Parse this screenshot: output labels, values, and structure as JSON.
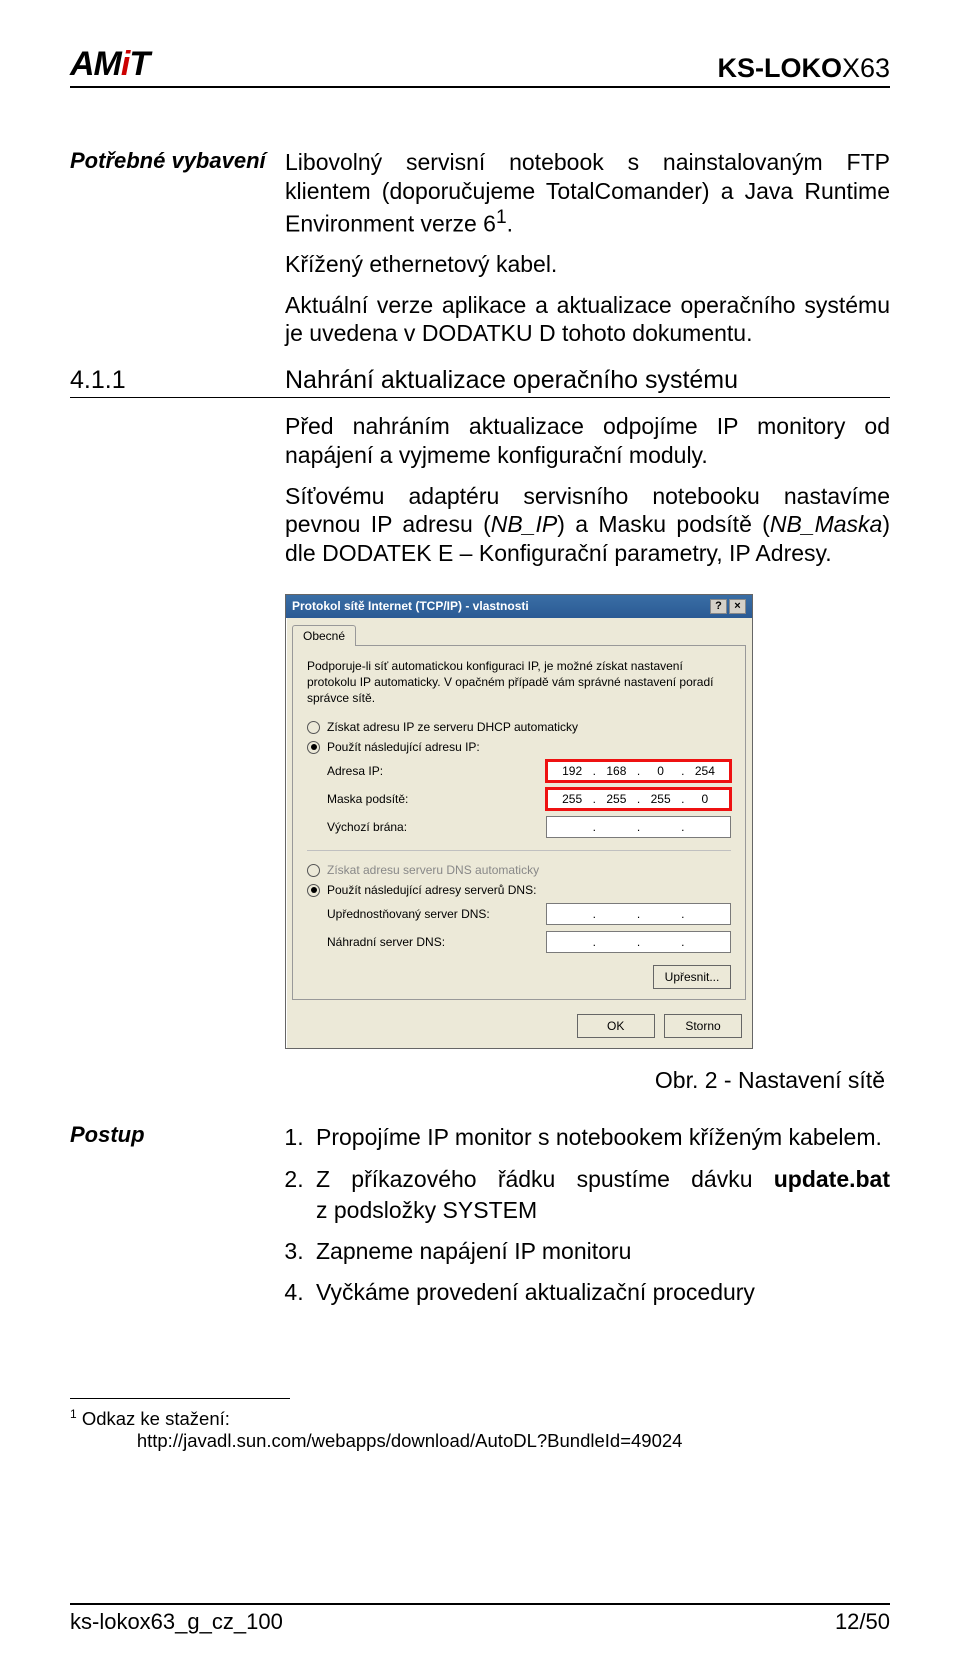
{
  "header": {
    "logo_a": "AM",
    "logo_i": "i",
    "logo_t": "T",
    "doc_id": "KS-LOKO",
    "doc_id_thin": "X63"
  },
  "margin": {
    "equip": "Potřebné vybavení",
    "proc": "Postup"
  },
  "para": {
    "p1a": "Libovolný servisní notebook s nainstalovaným FTP klientem (doporučujeme TotalComander) a Java Runtime Environment verze 6",
    "p1sup": "1",
    "p1b": ".",
    "p2": "Křížený ethernetový kabel.",
    "p3": "Aktuální verze aplikace a aktualizace operačního systému je uvedena v DODATKU D tohoto dokumentu."
  },
  "section": {
    "num": "4.1.1",
    "title": "Nahrání aktualizace operačního systému"
  },
  "para2": {
    "p4": "Před nahráním aktualizace odpojíme IP monitory od napájení a vyjmeme konfigurační moduly.",
    "p5a": "Síťovému adaptéru servisního notebooku nastavíme pevnou IP adresu (",
    "p5b": "NB_IP",
    "p5c": ") a Masku podsítě (",
    "p5d": "NB_Maska",
    "p5e": ") dle DODATEK E – Konfigurační parametry, IP Adresy."
  },
  "dialog": {
    "title": "Protokol sítě Internet (TCP/IP) - vlastnosti",
    "help": "?",
    "close": "×",
    "tab": "Obecné",
    "desc": "Podporuje-li síť automatickou konfiguraci IP, je možné získat nastavení protokolu IP automaticky. V opačném případě vám správné nastavení poradí správce sítě.",
    "r1": "Získat adresu IP ze serveru DHCP automaticky",
    "r2": "Použít následující adresu IP:",
    "f_ip": "Adresa IP:",
    "f_mask": "Maska podsítě:",
    "f_gw": "Výchozí brána:",
    "ip": [
      "192",
      "168",
      "0",
      "254"
    ],
    "mask": [
      "255",
      "255",
      "255",
      "0"
    ],
    "r3": "Získat adresu serveru DNS automaticky",
    "r4": "Použít následující adresy serverů DNS:",
    "f_dns1": "Upřednostňovaný server DNS:",
    "f_dns2": "Náhradní server DNS:",
    "adv": "Upřesnit...",
    "ok": "OK",
    "cancel": "Storno"
  },
  "caption": "Obr. 2 -   Nastavení sítě",
  "steps": {
    "s1": "Propojíme IP monitor s notebookem kříženým kabelem.",
    "s2a": "Z ",
    "s2b": "příkazového",
    "s2c": "řádku",
    "s2d": "spustíme",
    "s2e": "dávku",
    "s2bold": "update.bat",
    "s2f": "z podsložky SYSTEM",
    "s3": "Zapneme napájení IP monitoru",
    "s4": "Vyčkáme provedení aktualizační procedury"
  },
  "footnote": {
    "sup": "1",
    "label": " Odkaz ke stažení:",
    "url": "http://javadl.sun.com/webapps/download/AutoDL?BundleId=49024"
  },
  "footer": {
    "left": "ks-lokox63_g_cz_100",
    "right": "12/50"
  }
}
